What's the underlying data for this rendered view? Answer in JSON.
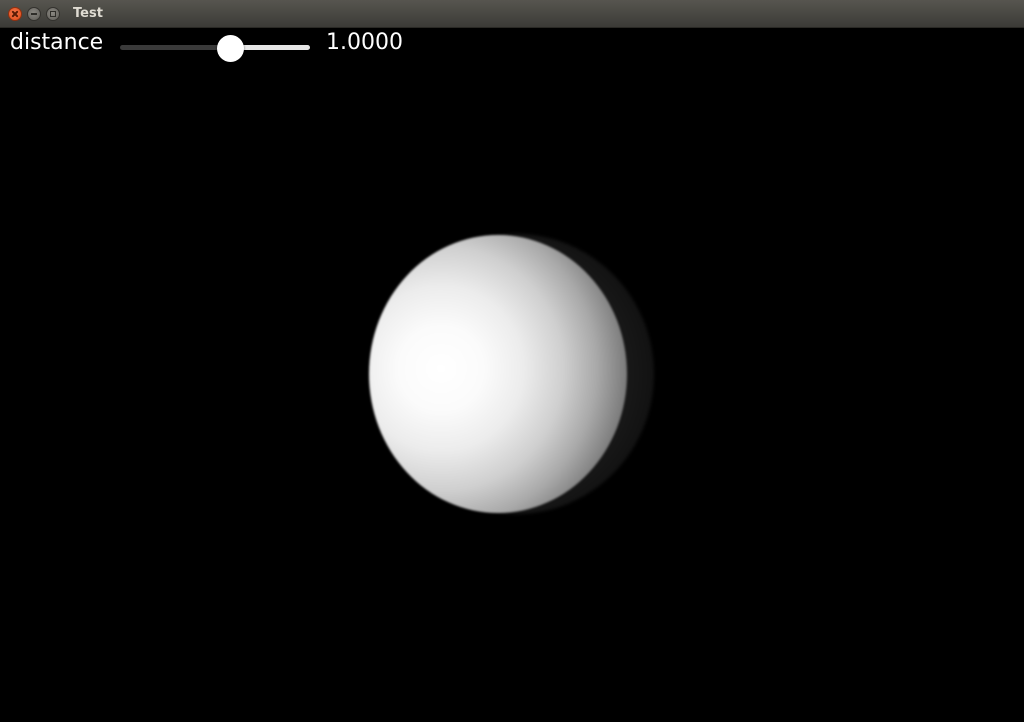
{
  "window": {
    "title": "Test"
  },
  "controls": {
    "parameter_label": "distance",
    "slider_fraction": 0.58,
    "value_text": "1.0000"
  },
  "scene": {
    "background_color": "#000000",
    "sphere_color": "#ffffff"
  }
}
